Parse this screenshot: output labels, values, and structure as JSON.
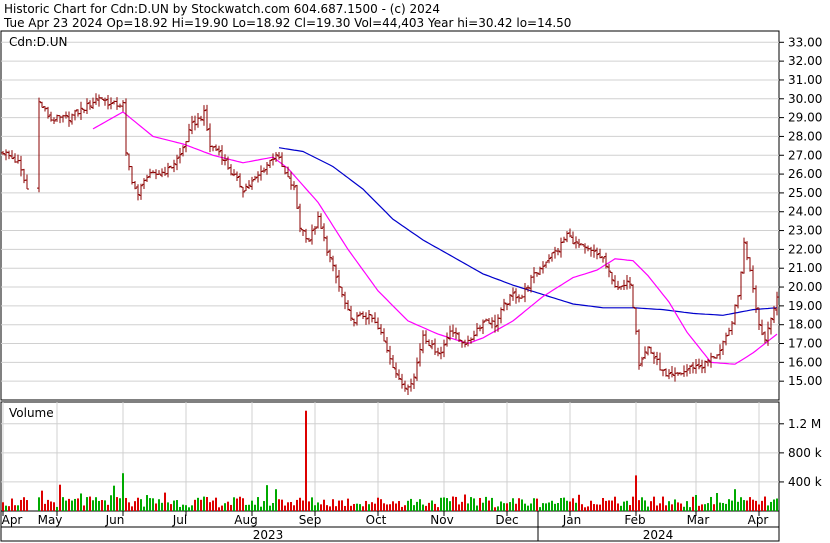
{
  "header": {
    "title_line": "Historic Chart for Cdn:D.UN by Stockwatch.com 604.687.1500 - (c) 2024",
    "stats_line": "Tue Apr 23 2024   Op=18.92  Hi=19.90  Lo=18.92  Cl=19.30  Vol=44,403   Year hi=30.42  lo=14.50"
  },
  "chart_data": {
    "type": "ohlc",
    "symbol_label": "Cdn:D.UN",
    "price_axis": {
      "ylim": [
        14.0,
        33.6
      ],
      "ticks": [
        "15.00",
        "16.00",
        "17.00",
        "18.00",
        "19.00",
        "20.00",
        "21.00",
        "22.00",
        "23.00",
        "24.00",
        "25.00",
        "26.00",
        "27.00",
        "28.00",
        "29.00",
        "30.00",
        "31.00",
        "32.00",
        "33.00"
      ]
    },
    "volume_panel": {
      "label": "Volume",
      "ylim": [
        0,
        1500000
      ],
      "ticks": [
        "400 k",
        "800 k",
        "1.2 M"
      ]
    },
    "x_axis": {
      "months": [
        "Apr",
        "May",
        "Jun",
        "Jul",
        "Aug",
        "Sep",
        "Oct",
        "Nov",
        "Dec",
        "Jan",
        "Feb",
        "Mar",
        "Apr"
      ],
      "years": [
        "2023",
        "2024"
      ]
    },
    "colors": {
      "candle": "#8b0000",
      "ma_short": "#ff00ff",
      "ma_long": "#0000cc",
      "vol_up": "#00aa00",
      "vol_down": "#dd0000",
      "grid": "#d0d0d0"
    },
    "price_anchors": [
      [
        0,
        27.2
      ],
      [
        5,
        26.6
      ],
      [
        8,
        25.2
      ],
      [
        12,
        29.8
      ],
      [
        16,
        28.9
      ],
      [
        22,
        29.0
      ],
      [
        28,
        29.6
      ],
      [
        32,
        30.1
      ],
      [
        36,
        29.7
      ],
      [
        40,
        29.7
      ],
      [
        41,
        27.0
      ],
      [
        43,
        25.7
      ],
      [
        45,
        24.8
      ],
      [
        47,
        25.8
      ],
      [
        51,
        26.0
      ],
      [
        55,
        26.2
      ],
      [
        59,
        27.0
      ],
      [
        63,
        28.6
      ],
      [
        67,
        29.2
      ],
      [
        69,
        27.5
      ],
      [
        72,
        27.2
      ],
      [
        76,
        26.1
      ],
      [
        80,
        25.2
      ],
      [
        84,
        25.7
      ],
      [
        88,
        26.5
      ],
      [
        91,
        27.1
      ],
      [
        94,
        26.0
      ],
      [
        97,
        25.2
      ],
      [
        99,
        23.2
      ],
      [
        102,
        22.5
      ],
      [
        105,
        23.6
      ],
      [
        108,
        22.0
      ],
      [
        112,
        20.0
      ],
      [
        116,
        18.2
      ],
      [
        120,
        18.5
      ],
      [
        123,
        18.3
      ],
      [
        126,
        17.5
      ],
      [
        129,
        16.3
      ],
      [
        132,
        15.0
      ],
      [
        134,
        14.7
      ],
      [
        137,
        15.2
      ],
      [
        140,
        17.5
      ],
      [
        143,
        16.8
      ],
      [
        146,
        16.5
      ],
      [
        149,
        17.8
      ],
      [
        152,
        17.2
      ],
      [
        155,
        17.0
      ],
      [
        158,
        17.8
      ],
      [
        161,
        18.3
      ],
      [
        164,
        18.0
      ],
      [
        167,
        19.0
      ],
      [
        170,
        19.6
      ],
      [
        173,
        19.5
      ],
      [
        176,
        20.4
      ],
      [
        179,
        21.0
      ],
      [
        182,
        21.6
      ],
      [
        185,
        22.0
      ],
      [
        188,
        22.8
      ],
      [
        191,
        22.3
      ],
      [
        194,
        22.0
      ],
      [
        197,
        21.8
      ],
      [
        200,
        21.5
      ],
      [
        203,
        20.3
      ],
      [
        206,
        19.9
      ],
      [
        209,
        20.3
      ],
      [
        211,
        17.8
      ],
      [
        212,
        16.0
      ],
      [
        215,
        16.8
      ],
      [
        218,
        16.0
      ],
      [
        221,
        15.2
      ],
      [
        224,
        15.3
      ],
      [
        227,
        15.5
      ],
      [
        230,
        15.8
      ],
      [
        233,
        15.8
      ],
      [
        236,
        16.2
      ],
      [
        239,
        16.6
      ],
      [
        242,
        17.6
      ],
      [
        245,
        19.5
      ],
      [
        247,
        22.3
      ],
      [
        249,
        21.0
      ],
      [
        252,
        18.0
      ],
      [
        254,
        17.2
      ],
      [
        256,
        18.5
      ],
      [
        258,
        19.3
      ]
    ],
    "ma_short_anchors": [
      [
        30,
        28.4
      ],
      [
        40,
        29.3
      ],
      [
        50,
        28.0
      ],
      [
        60,
        27.6
      ],
      [
        70,
        27.0
      ],
      [
        80,
        26.6
      ],
      [
        90,
        26.9
      ],
      [
        95,
        26.3
      ],
      [
        105,
        24.5
      ],
      [
        115,
        22.0
      ],
      [
        125,
        19.8
      ],
      [
        135,
        18.2
      ],
      [
        145,
        17.5
      ],
      [
        155,
        17.0
      ],
      [
        160,
        17.3
      ],
      [
        170,
        18.2
      ],
      [
        180,
        19.5
      ],
      [
        190,
        20.5
      ],
      [
        198,
        20.9
      ],
      [
        204,
        21.5
      ],
      [
        210,
        21.4
      ],
      [
        215,
        20.6
      ],
      [
        222,
        19.2
      ],
      [
        228,
        17.6
      ],
      [
        236,
        16.0
      ],
      [
        244,
        15.9
      ],
      [
        250,
        16.5
      ],
      [
        258,
        17.5
      ]
    ],
    "ma_long_anchors": [
      [
        92,
        27.4
      ],
      [
        100,
        27.2
      ],
      [
        110,
        26.4
      ],
      [
        120,
        25.2
      ],
      [
        130,
        23.6
      ],
      [
        140,
        22.5
      ],
      [
        150,
        21.6
      ],
      [
        160,
        20.7
      ],
      [
        170,
        20.1
      ],
      [
        180,
        19.6
      ],
      [
        190,
        19.1
      ],
      [
        200,
        18.9
      ],
      [
        210,
        18.9
      ],
      [
        220,
        18.8
      ],
      [
        230,
        18.6
      ],
      [
        240,
        18.5
      ],
      [
        250,
        18.8
      ],
      [
        258,
        18.9
      ]
    ],
    "volume_spikes": [
      [
        0,
        120000
      ],
      [
        13,
        280000
      ],
      [
        40,
        520000
      ],
      [
        101,
        1380000
      ],
      [
        163,
        180000
      ],
      [
        211,
        490000
      ],
      [
        231,
        220000
      ],
      [
        244,
        300000
      ]
    ]
  }
}
